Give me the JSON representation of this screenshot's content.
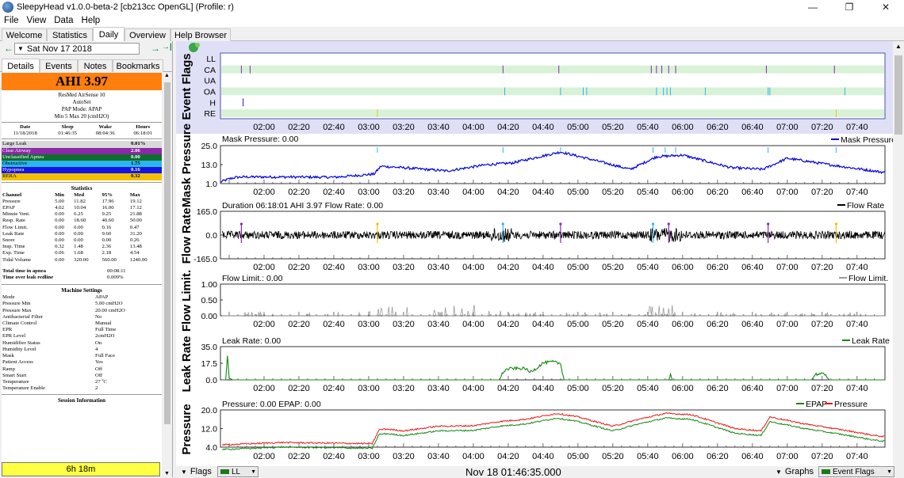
{
  "window": {
    "title": "SleepyHead v1.0.0-beta-2 [cb213cc OpenGL] (Profile: r)",
    "minimize": "—",
    "restore": "❐",
    "close": "✕"
  },
  "menu": [
    "File",
    "View",
    "Data",
    "Help"
  ],
  "tabs": [
    "Welcome",
    "Statistics",
    "Daily",
    "Overview",
    "Help Browser"
  ],
  "date_nav": {
    "prev": "←",
    "date": "Sat Nov 17 2018",
    "next": "→",
    "last": "→|"
  },
  "subtabs": [
    "Details",
    "Events",
    "Notes",
    "Bookmarks"
  ],
  "ahi": "AHI 3.97",
  "device": [
    "ResMed AirSense 10",
    "AutoSet",
    "PAP Mode: APAP",
    "Min 5 Max 20 (cmH2O)"
  ],
  "summary": {
    "headers": [
      "Date",
      "Sleep",
      "Wake",
      "Hours"
    ],
    "values": [
      "11/18/2018",
      "01:46:35",
      "08:04:36",
      "06:18:01"
    ]
  },
  "events": [
    {
      "name": "Large Leak",
      "value": "0.01%",
      "color": "#d9d9d9",
      "text": "#000000"
    },
    {
      "name": "Clear Airway",
      "value": "2.06",
      "color": "#8b2aa8",
      "text": "#ffffff"
    },
    {
      "name": "Unclassified Apnea",
      "value": "0.00",
      "color": "#0f6e2e",
      "text": "#ffffff"
    },
    {
      "name": "Obstructive",
      "value": "1.75",
      "color": "#2ab8ea",
      "text": "#000000"
    },
    {
      "name": "Hypopnea",
      "value": "0.16",
      "color": "#1414e8",
      "text": "#ffffff"
    },
    {
      "name": "RERA",
      "value": "0.32",
      "color": "#f2c200",
      "text": "#000000"
    }
  ],
  "statistics": {
    "title": "Statistics",
    "headers": [
      "Channel",
      "Min",
      "Med",
      "95%",
      "Max"
    ],
    "rows": [
      [
        "Pressure",
        "5.00",
        "11.82",
        "17.96",
        "19.12"
      ],
      [
        "EPAP",
        "4.02",
        "10.04",
        "16.00",
        "17.12"
      ],
      [
        "Minute Vent.",
        "0.00",
        "6.25",
        "9.25",
        "21.88"
      ],
      [
        "Resp. Rate",
        "0.00",
        "18.60",
        "40.60",
        "50.00"
      ],
      [
        "Flow Limit.",
        "0.00",
        "0.00",
        "0.16",
        "0.47"
      ],
      [
        "Leak Rate",
        "0.00",
        "0.00",
        "9.60",
        "31.20"
      ],
      [
        "Snore",
        "0.00",
        "0.00",
        "0.00",
        "0.26"
      ],
      [
        "Insp. Time",
        "0.32",
        "1.48",
        "2.36",
        "13.48"
      ],
      [
        "Exp. Time",
        "0.06",
        "1.68",
        "2.18",
        "4.54"
      ],
      [
        "Tidal Volume",
        "0.00",
        "320.00",
        "560.00",
        "1240.00"
      ]
    ],
    "apnea_label": "Total time in apnea",
    "apnea_value": "00:08:11",
    "leak_label": "Time over leak redline",
    "leak_value": "0.009%"
  },
  "machine_settings": {
    "title": "Machine Settings",
    "rows": [
      [
        "Mode",
        "APAP"
      ],
      [
        "Pressure Min",
        "5.00 cmH2O"
      ],
      [
        "Pressure Max",
        "20.00 cmH2O"
      ],
      [
        "Antibacterial Filter",
        "No"
      ],
      [
        "Climate Control",
        "Manual"
      ],
      [
        "EPR",
        "Full Time"
      ],
      [
        "EPR Level",
        "2cmH2O"
      ],
      [
        "Humidifier Status",
        "On"
      ],
      [
        "Humidity Level",
        "4"
      ],
      [
        "Mask",
        "Full Face"
      ],
      [
        "Patient Access",
        "Yes"
      ],
      [
        "Ramp",
        "Off"
      ],
      [
        "Smart Start",
        "Off"
      ],
      [
        "Temperature",
        "27 ºC"
      ],
      [
        "Temperature Enable",
        "2"
      ]
    ]
  },
  "session_info": "Session Information",
  "session_duration": "6h 18m",
  "time_ticks": [
    "02:00",
    "02:20",
    "02:40",
    "03:00",
    "03:20",
    "03:40",
    "04:00",
    "04:20",
    "04:40",
    "05:00",
    "05:20",
    "05:40",
    "06:00",
    "06:20",
    "06:40",
    "07:00",
    "07:20",
    "07:40"
  ],
  "graphs": {
    "flags": {
      "title": "Event Flags",
      "rows": [
        "LL",
        "CA",
        "UA",
        "OA",
        "H",
        "RE"
      ]
    },
    "mask": {
      "title": "Mask Pressure",
      "caption": "Mask Pressure: 0.00",
      "legend": "Mask Pressure",
      "ticks": [
        "25.0",
        "13.0",
        "1.0"
      ],
      "color": "#0000e0"
    },
    "flow": {
      "title": "Flow Rate",
      "caption": "Duration 06:18:01  AHI 3.97  Flow Rate: 0.00",
      "legend": "Flow Rate",
      "ticks": [
        "165.0",
        "0.0",
        "-165.0"
      ]
    },
    "flowlimit": {
      "title": "Flow Limit.",
      "caption": "Flow Limit.: 0.00",
      "legend": "Flow Limit.",
      "ticks": [
        "1.00",
        "0.50",
        "0.00"
      ]
    },
    "leak": {
      "title": "Leak Rate",
      "caption": "Leak Rate: 0.00",
      "legend": "Leak Rate",
      "ticks": [
        "35.0",
        "17.5",
        "0.0"
      ],
      "color": "#118811"
    },
    "pressure": {
      "title": "Pressure",
      "caption": "Pressure: 0.00 EPAP: 0.00",
      "legend_a": "EPAP",
      "legend_b": "Pressure",
      "ticks": [
        "20.0",
        "12.0",
        "4.0"
      ],
      "color_a": "#118811",
      "color_b": "#ee1111"
    }
  },
  "statusbar": {
    "flags_label": "Flags",
    "flags_select": "LL",
    "time": "Nov 18 01:46:35.000",
    "graphs_label": "Graphs",
    "graphs_select": "Event Flags"
  }
}
